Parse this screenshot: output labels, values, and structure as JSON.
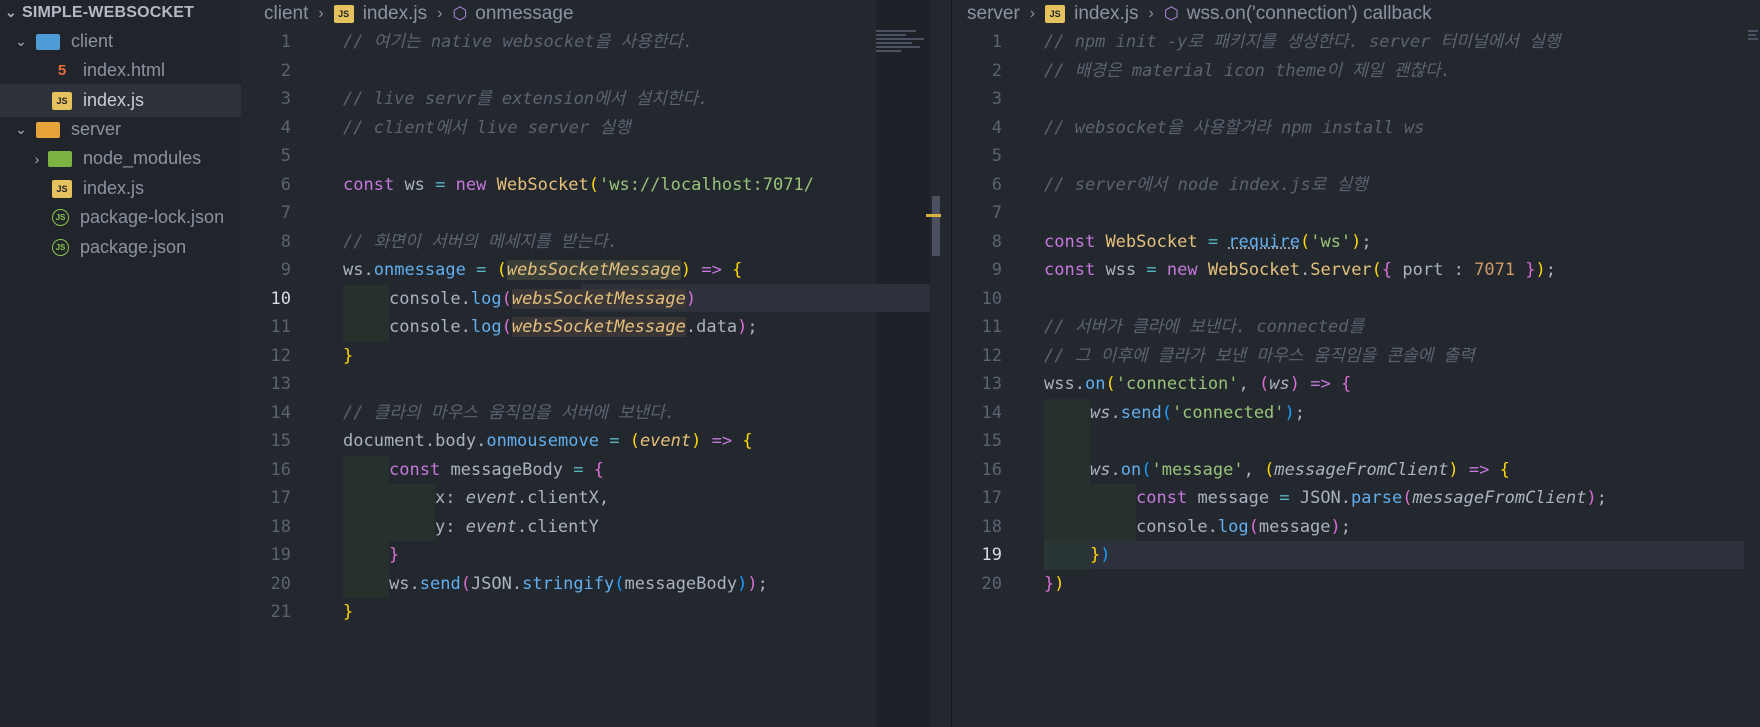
{
  "explorer": {
    "root_label": "SIMPLE-WEBSOCKET",
    "items": [
      {
        "label": "client",
        "type": "folder-blue",
        "chevron": "v"
      },
      {
        "label": "index.html",
        "type": "html"
      },
      {
        "label": "index.js",
        "type": "js"
      },
      {
        "label": "server",
        "type": "folder-orange",
        "chevron": "v"
      },
      {
        "label": "node_modules",
        "type": "folder-green",
        "chevron": ">"
      },
      {
        "label": "index.js",
        "type": "js"
      },
      {
        "label": "package-lock.json",
        "type": "json"
      },
      {
        "label": "package.json",
        "type": "json"
      }
    ]
  },
  "left_editor": {
    "breadcrumb": [
      "client",
      "index.js",
      "onmessage"
    ],
    "active_line": 10
  },
  "right_editor": {
    "breadcrumb": [
      "server",
      "index.js",
      "wss.on('connection') callback"
    ],
    "active_line": 19
  },
  "icons": {
    "js_label": "JS",
    "html_label": "5",
    "json_label": "JS"
  }
}
